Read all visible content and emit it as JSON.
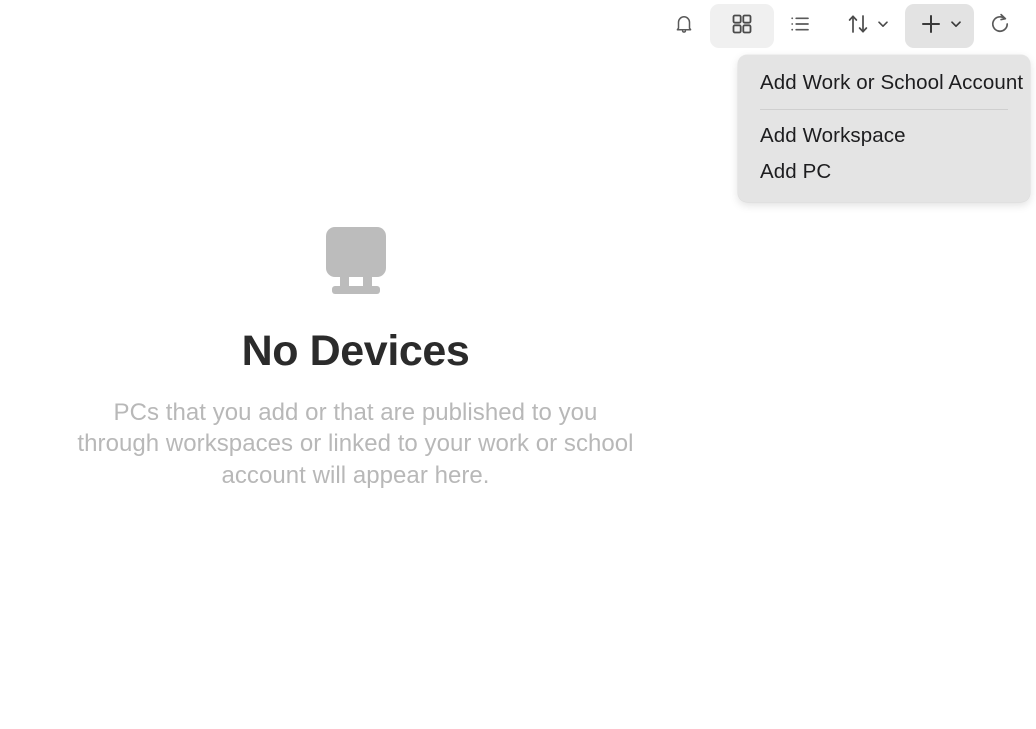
{
  "toolbar": {
    "buttons": [
      {
        "name": "notifications-button",
        "icon": "bell-icon",
        "label": "Notifications",
        "state": "default"
      },
      {
        "name": "grid-view-button",
        "icon": "grid-view-icon",
        "label": "Grid view",
        "state": "selected"
      },
      {
        "name": "list-view-button",
        "icon": "list-view-icon",
        "label": "List view",
        "state": "default"
      },
      {
        "name": "sort-button",
        "icon": "sort-icon",
        "label": "Sort",
        "state": "default"
      },
      {
        "name": "add-button",
        "icon": "plus-icon",
        "label": "Add",
        "state": "pressed"
      },
      {
        "name": "refresh-button",
        "icon": "refresh-icon",
        "label": "Refresh",
        "state": "default"
      }
    ]
  },
  "add_menu": {
    "visible": true,
    "items": [
      {
        "label": "Add Work or School Account",
        "name": "menu-item-add-work-or-school-account"
      },
      {
        "label": "Add Workspace",
        "name": "menu-item-add-workspace"
      },
      {
        "label": "Add PC",
        "name": "menu-item-add-pc"
      }
    ],
    "separator_after_index": 0,
    "background_color": "#E4E4E4"
  },
  "empty_state": {
    "icon": "monitor-icon",
    "title": "No Devices",
    "description": "PCs that you add or that are published to you through workspaces or linked to your work or school account will appear here.",
    "title_color": "#2B2B2B",
    "description_color": "#B8B8B8",
    "icon_color": "#BCBCBC"
  },
  "colors": {
    "background": "#FFFFFF",
    "toolbar_selected": "#F0F0F0",
    "toolbar_pressed": "#E3E3E3",
    "menu_separator": "#CFCFCF",
    "icon_stroke": "#5A5A5A"
  }
}
